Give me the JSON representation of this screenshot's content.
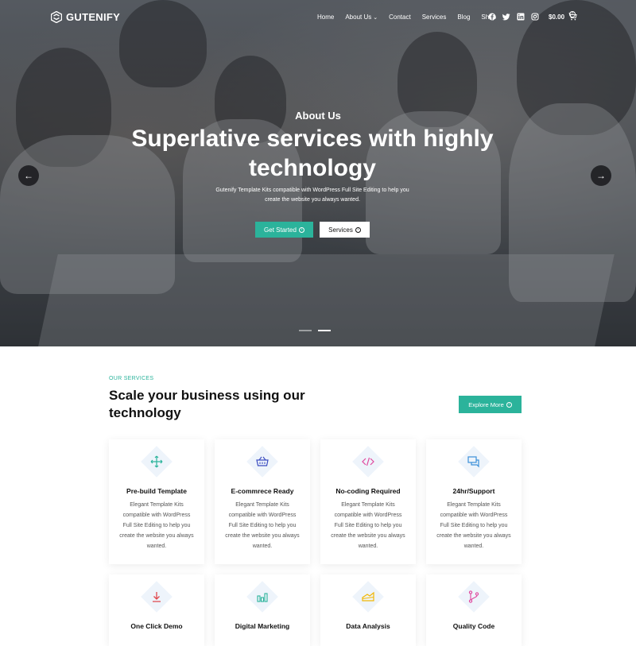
{
  "brand": {
    "name": "GUTENIFY"
  },
  "nav": {
    "items": [
      {
        "label": "Home",
        "has_dropdown": false
      },
      {
        "label": "About Us",
        "has_dropdown": true
      },
      {
        "label": "Contact",
        "has_dropdown": false
      },
      {
        "label": "Services",
        "has_dropdown": false
      },
      {
        "label": "Blog",
        "has_dropdown": false
      },
      {
        "label": "Shop",
        "has_dropdown": false
      }
    ],
    "social_icons": [
      "facebook-icon",
      "twitter-icon",
      "linkedin-icon",
      "instagram-icon"
    ],
    "cart_total": "$0.00",
    "cart_count": "0"
  },
  "hero": {
    "subtitle": "About Us",
    "title": "Superlative services with highly technology",
    "description": "Gutenify Template Kits compatible with WordPress Full Site Editing to help you create the website you always wanted.",
    "primary_button": "Get Started",
    "secondary_button": "Services",
    "slides_total": 2,
    "active_slide": 2
  },
  "services": {
    "eyebrow": "OUR SERVICES",
    "title": "Scale your business using our technology",
    "button": "Explore More",
    "cards": [
      {
        "title": "Pre-build Template",
        "desc": "Elegant Template Kits compatible with WordPress Full Site Editing to help you create the website you always wanted.",
        "icon": "move-arrows-icon",
        "color": "#2bb39b"
      },
      {
        "title": "E-commrece Ready",
        "desc": "Elegant Template Kits compatible with WordPress Full Site Editing to help you create the website you always wanted.",
        "icon": "basket-icon",
        "color": "#3b4cc0"
      },
      {
        "title": "No-coding Required",
        "desc": "Elegant Template Kits compatible with WordPress Full Site Editing to help you create the website you always wanted.",
        "icon": "code-icon",
        "color": "#e0479e"
      },
      {
        "title": "24hr/Support",
        "desc": "Elegant Template Kits compatible with WordPress Full Site Editing to help you create the website you always wanted.",
        "icon": "chat-icon",
        "color": "#3b8fd9"
      },
      {
        "title": "One Click Demo",
        "desc": "",
        "icon": "download-icon",
        "color": "#e0474c"
      },
      {
        "title": "Digital Marketing",
        "desc": "",
        "icon": "bar-chart-icon",
        "color": "#2bb39b"
      },
      {
        "title": "Data Analysis",
        "desc": "",
        "icon": "analytics-icon",
        "color": "#f2b705"
      },
      {
        "title": "Quality Code",
        "desc": "",
        "icon": "git-branch-icon",
        "color": "#e0479e"
      }
    ]
  },
  "colors": {
    "accent": "#2bb39b",
    "dark": "#111111"
  }
}
